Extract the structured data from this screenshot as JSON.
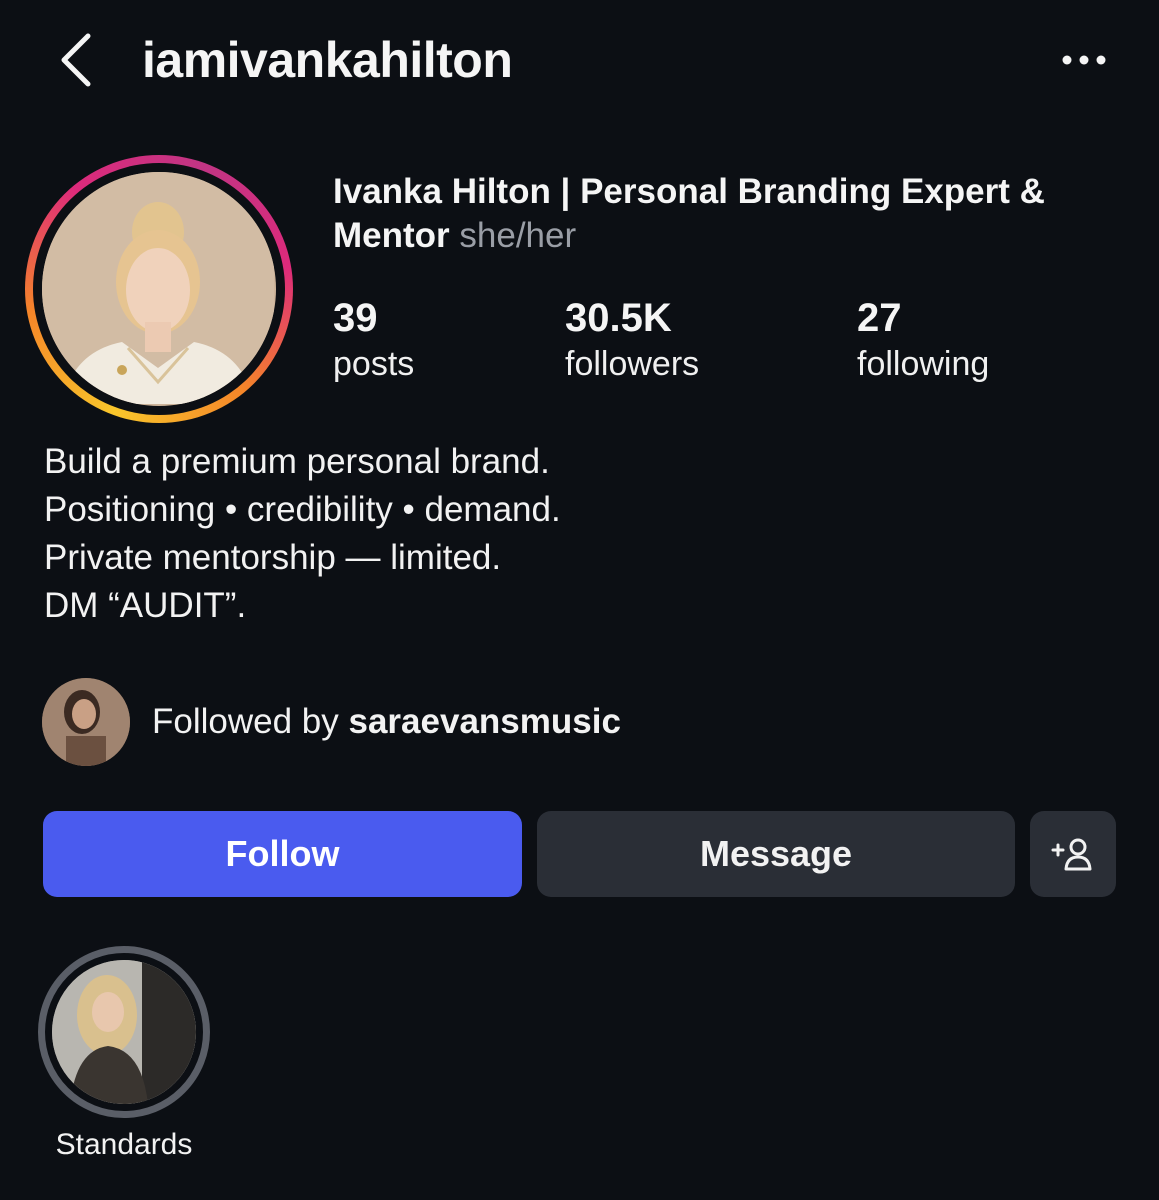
{
  "header": {
    "username": "iamivankahilton",
    "back_icon": "chevron-left-icon",
    "more_icon": "more-horizontal-icon"
  },
  "profile": {
    "display_name": "Ivanka Hilton | Personal Branding Expert & Mentor",
    "pronouns": "she/her",
    "avatar": "profile-photo",
    "story_ring_colors": [
      "#f9c62b",
      "#f58529",
      "#dd2a7b",
      "#c13584"
    ]
  },
  "stats": [
    {
      "value": "39",
      "label": "posts"
    },
    {
      "value": "30.5K",
      "label": "followers"
    },
    {
      "value": "27",
      "label": "following"
    }
  ],
  "bio": [
    "Build a premium personal brand.",
    "Positioning • credibility • demand.",
    "Private mentorship — limited.",
    "DM “AUDIT”."
  ],
  "followed_by": {
    "prefix": "Followed by",
    "username": "saraevansmusic"
  },
  "actions": {
    "follow_label": "Follow",
    "message_label": "Message",
    "add_icon": "add-person-icon",
    "follow_color": "#4a5bef",
    "secondary_color": "#2a2e36"
  },
  "highlights": [
    {
      "label": "Standards"
    }
  ]
}
